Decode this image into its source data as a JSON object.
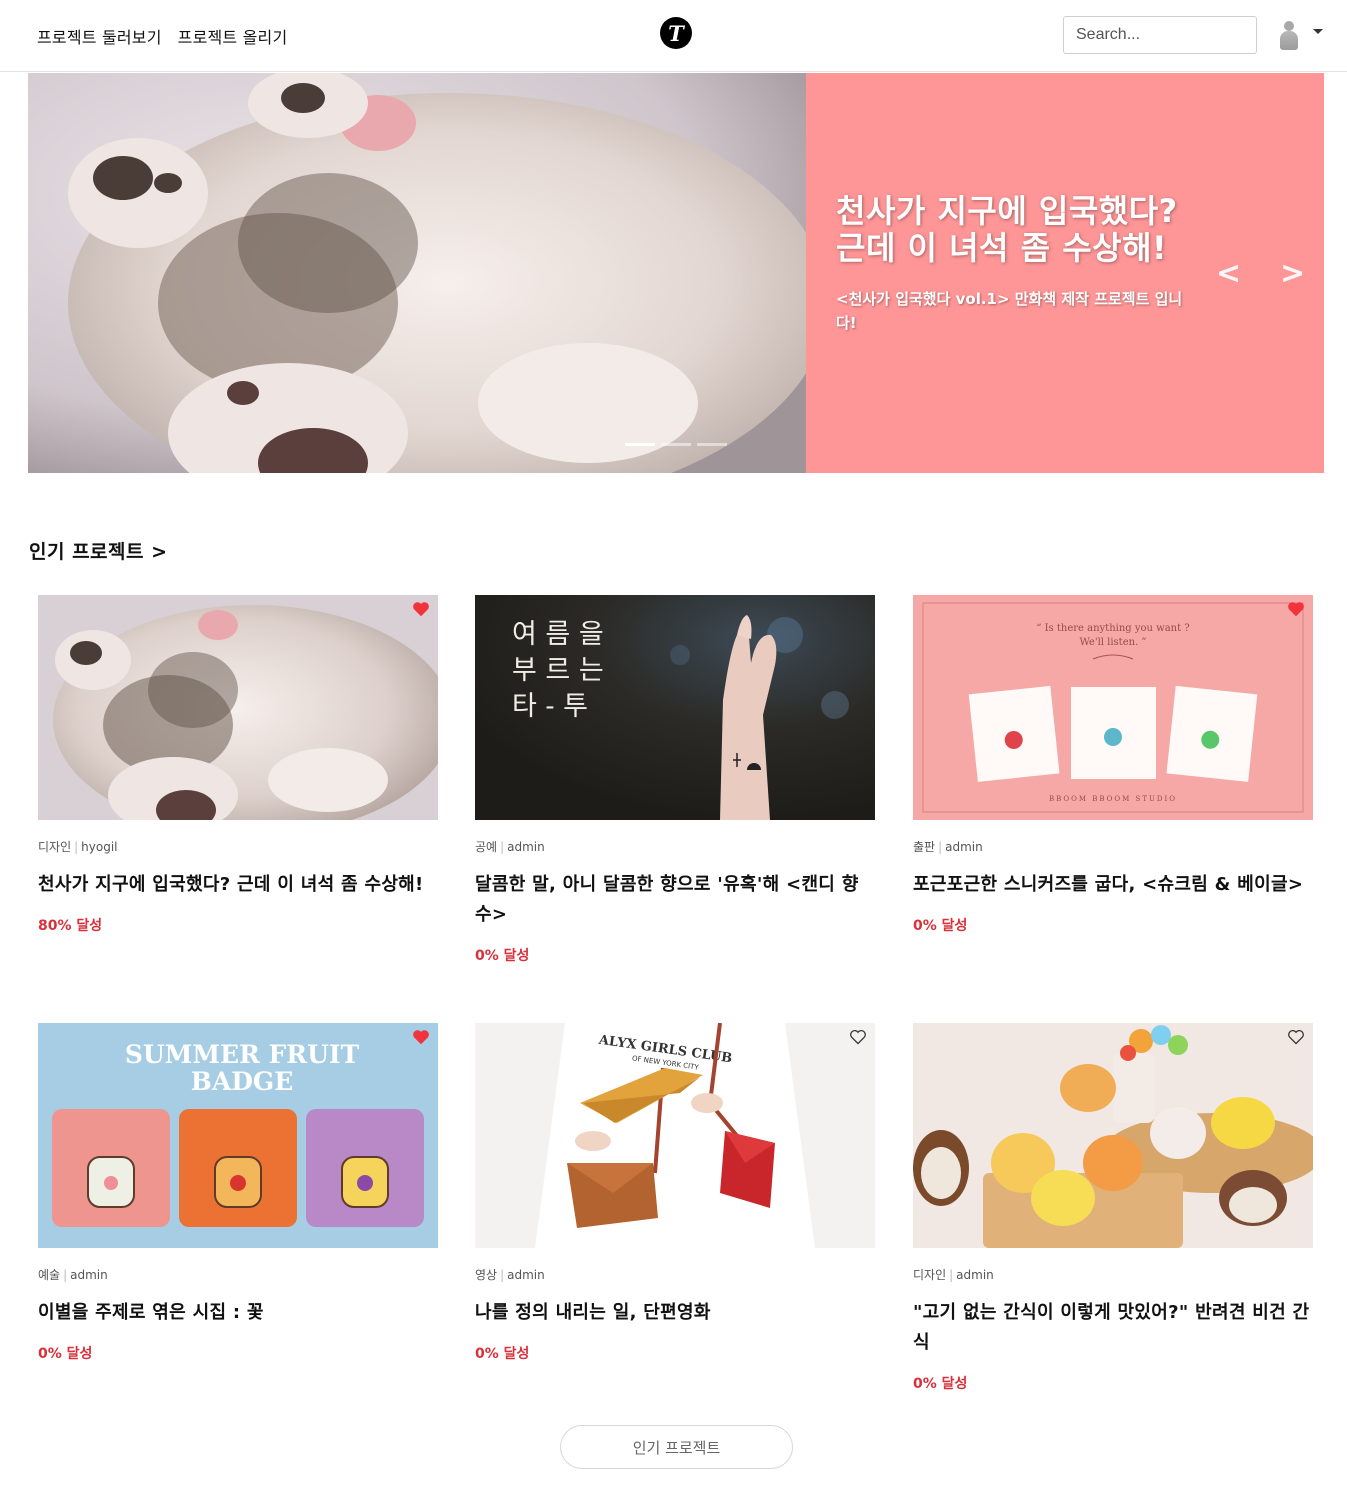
{
  "nav": {
    "links": [
      "프로젝트 둘러보기",
      "프로젝트 올리기"
    ],
    "logo_letter": "T",
    "search_placeholder": "Search..."
  },
  "hero": {
    "title_line1": "천사가 지구에 입국했다?",
    "title_line2": "근데 이 녀석 좀 수상해!",
    "subtitle": "<천사가 입국했다 vol.1> 만화책 제작 프로젝트 입니다!",
    "prev_arrow": "<",
    "next_arrow": ">",
    "slide_count": 3,
    "active_slide": 0,
    "panel_color": "#fe9596"
  },
  "section": {
    "title": "인기 프로젝트 >"
  },
  "projects": [
    {
      "category": "디자인",
      "author": "hyogil",
      "title": "천사가 지구에 입국했다? 근데 이 녀석 좀 수상해!",
      "rate": "80% 달성",
      "liked": true,
      "image": "kitten"
    },
    {
      "category": "공예",
      "author": "admin",
      "title": "달콤한 말, 아니 달콤한 향으로 '유혹'해 <캔디 향수>",
      "rate": "0% 달성",
      "liked": false,
      "image": "tattoo",
      "image_text": [
        "여 름 을",
        "부 르 는",
        "타 - 투"
      ]
    },
    {
      "category": "출판",
      "author": "admin",
      "title": "포근포근한 스니커즈를 굽다, <슈크림 & 베이글>",
      "rate": "0% 달성",
      "liked": true,
      "image": "postcards",
      "image_text": [
        "“ Is there anything you want ?",
        "We'll listen. ”",
        "BBOOM BBOOM STUDIO"
      ]
    },
    {
      "category": "예술",
      "author": "admin",
      "title": "이별을 주제로 엮은 시집 : 꽃",
      "rate": "0% 달성",
      "liked": true,
      "image": "badges",
      "image_text": [
        "SUMMER FRUIT",
        "BADGE"
      ]
    },
    {
      "category": "영상",
      "author": "admin",
      "title": "나를 정의 내리는 일, 단편영화",
      "rate": "0% 달성",
      "liked": false,
      "image": "bags",
      "image_text": [
        "ALYX GIRLS CLUB",
        "OF NEW YORK CITY"
      ]
    },
    {
      "category": "디자인",
      "author": "admin",
      "title": "\"고기 없는 간식이 이렇게 맛있어?\" 반려견 비건 간식",
      "rate": "0% 달성",
      "liked": false,
      "image": "toys"
    }
  ],
  "more_button": "인기 프로젝트",
  "colors": {
    "accent_red": "#d9303a",
    "heart_red": "#f0333c",
    "hero_pink": "#fe9596"
  }
}
